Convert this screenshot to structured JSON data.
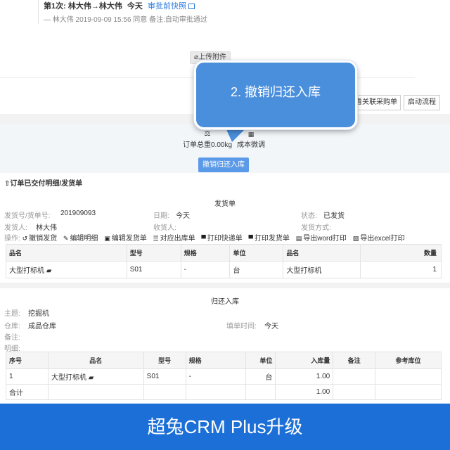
{
  "approval": {
    "round": "第1次:",
    "path": "林大伟→林大伟",
    "when": "今天",
    "snapshot_link": "审批前快照",
    "detail": "— 林大伟 2019-09-09 15:56 同意 备注:自动审批通过"
  },
  "upload_label": "上传附件",
  "callout_text": "2. 撤销归还入库",
  "actions": {
    "related": "看关联采购单",
    "flow": "启动流程"
  },
  "summary": {
    "weight": "订单总重0.00kg",
    "cost": "成本微调",
    "revoke": "撤销归还入库"
  },
  "section_title": "订单已交付明细/发货单",
  "shipping": {
    "title": "发货单",
    "fields": {
      "no_label": "发货号/货单号:",
      "no_value": "201909093",
      "date_label": "日期:",
      "date_value": "今天",
      "status_label": "状态:",
      "status_value": "已发货",
      "sender_label": "发货人:",
      "sender_value": "林大伟",
      "receiver_label": "收货人:",
      "method_label": "发货方式:"
    },
    "ops_label": "操作:",
    "ops": [
      "撤销发货",
      "编辑明细",
      "编辑发货单",
      "对应出库单",
      "打印快递单",
      "打印发货单",
      "导出word打印",
      "导出excel打印"
    ],
    "columns": [
      "品名",
      "型号",
      "规格",
      "单位",
      "品名",
      "数量"
    ],
    "rows": [
      [
        "大型打标机",
        "S01",
        "-",
        "台",
        "大型打标机",
        "1"
      ]
    ]
  },
  "return": {
    "title": "归还入库",
    "fields": {
      "subject_label": "主题:",
      "subject_value": "挖掘机",
      "warehouse_label": "仓库:",
      "warehouse_value": "成品仓库",
      "filltime_label": "填单时间:",
      "filltime_value": "今天",
      "note_label": "备注:",
      "detail_label": "明细:"
    },
    "columns": [
      "序号",
      "品名",
      "型号",
      "规格",
      "单位",
      "入库量",
      "备注",
      "参考库位"
    ],
    "rows": [
      [
        "1",
        "大型打标机",
        "S01",
        "-",
        "台",
        "1.00",
        "",
        ""
      ]
    ],
    "total_label": "合计",
    "total_qty": "1.00"
  },
  "banner_text": "超兔CRM Plus升级",
  "colors": {
    "accent": "#2f7de1",
    "callout": "#4a8fdc",
    "banner": "#1c6fd6",
    "button": "#5b9ae8"
  }
}
